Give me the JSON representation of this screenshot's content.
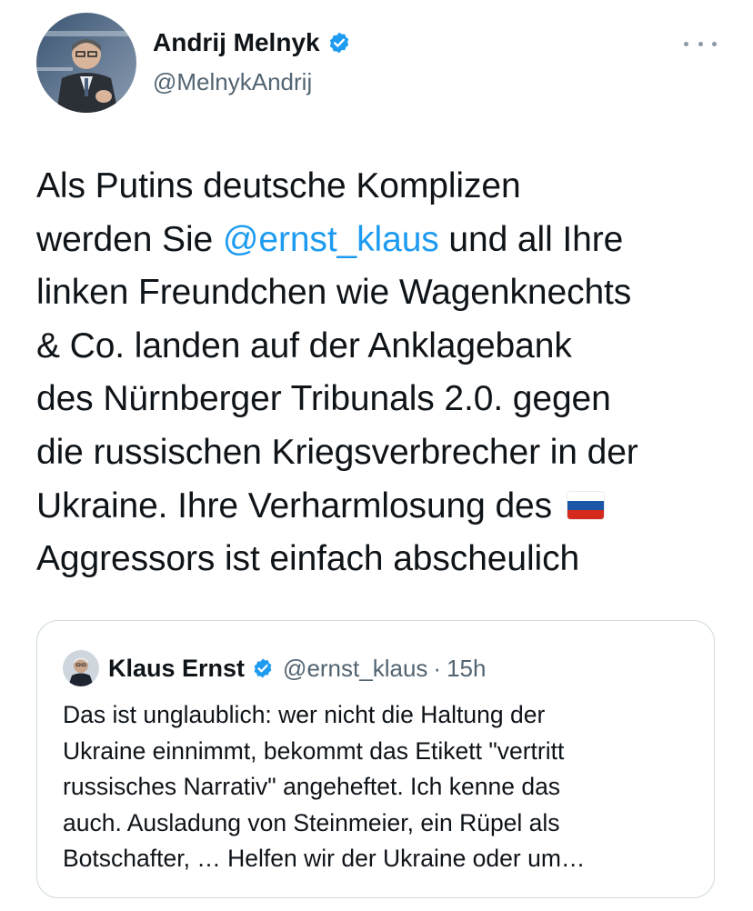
{
  "author": {
    "name": "Andrij Melnyk",
    "handle": "@MelnykAndrij"
  },
  "tweet": {
    "lines": [
      "Als Putins deutsche Komplizen",
      "werden Sie ",
      "linken Freundchen wie Wagenknechts",
      "& Co. landen auf der Anklagebank",
      "des Nürnberger Tribunals 2.0. gegen",
      "die russischen Kriegsverbrecher in der",
      "Ukraine. Ihre Verharmlosung des ",
      "Aggressors ist einfach abscheulich"
    ],
    "mention": "@ernst_klaus",
    "line2_after": " und all Ihre",
    "flag_icon": "russia-flag-icon"
  },
  "quoted": {
    "name": "Klaus Ernst",
    "handle": "@ernst_klaus",
    "separator": "·",
    "time": "15h",
    "lines": [
      "Das ist unglaublich: wer nicht die Haltung der",
      "Ukraine einnimmt, bekommt das Etikett \"vertritt",
      "russisches Narrativ\" angeheftet. Ich kenne das",
      "auch. Ausladung von Steinmeier, ein Rüpel als",
      "Botschafter, … Helfen wir der Ukraine oder um…"
    ]
  },
  "colors": {
    "link": "#1d9bf0",
    "verified": "#1d9bf0",
    "secondary_text": "#536471",
    "border": "#cfd9de"
  }
}
